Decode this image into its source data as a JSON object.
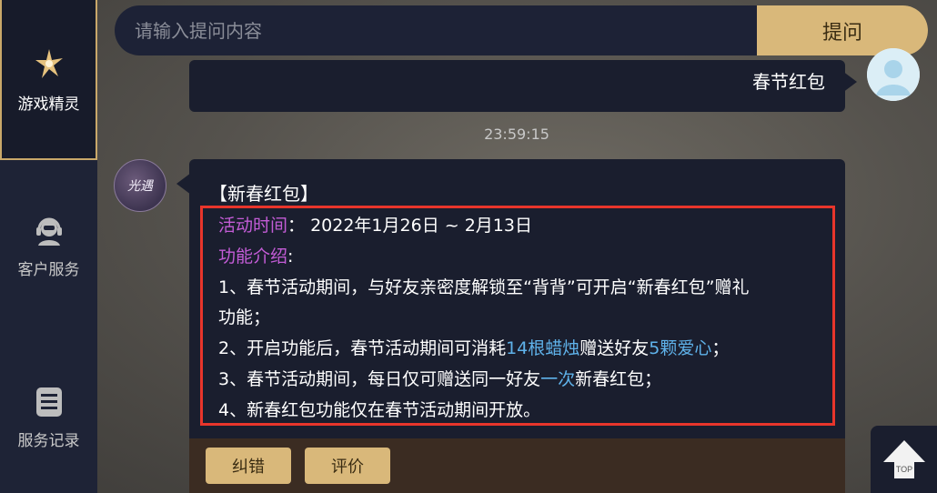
{
  "sidebar": {
    "items": [
      {
        "label": "游戏精灵",
        "icon": "sprite-icon",
        "active": true
      },
      {
        "label": "客户服务",
        "icon": "headset-icon",
        "active": false
      },
      {
        "label": "服务记录",
        "icon": "list-icon",
        "active": false
      }
    ]
  },
  "search": {
    "placeholder": "请输入提问内容",
    "button_label": "提问"
  },
  "conversation": {
    "user_message": "春节红包",
    "timestamp": "23:59:15",
    "bot_avatar_text": "光遇",
    "bot_reply": {
      "title": "【新春红包】",
      "time_label": "活动时间",
      "time_sep": "：",
      "time_value": "2022年1月26日 ~ 2月13日",
      "feature_label": "功能介绍",
      "feature_sep": ":",
      "line1a": "1、春节活动期间，与好友亲密度解锁至“背背”可开启“新春红包”赠礼",
      "line1b": "功能；",
      "line2_pre": "2、开启功能后，春节活动期间可消耗",
      "line2_hl1": "14根蜡烛",
      "line2_mid": "赠送好友",
      "line2_hl2": "5颗爱心",
      "line2_post": "；",
      "line3_pre": "3、春节活动期间，每日仅可赠送同一好友",
      "line3_hl": "一次",
      "line3_post": "新春红包；",
      "line4": "4、新春红包功能仅在春节活动期间开放。"
    },
    "actions": {
      "correct_label": "纠错",
      "rate_label": "评价"
    }
  },
  "top_button": {
    "label": "TOP",
    "icon": "arrow-up-icon"
  },
  "colors": {
    "accent_gold": "#d9b87a",
    "highlight_purple": "#c35cd6",
    "highlight_blue": "#5fb2ea",
    "frame_red": "#e8352b"
  }
}
